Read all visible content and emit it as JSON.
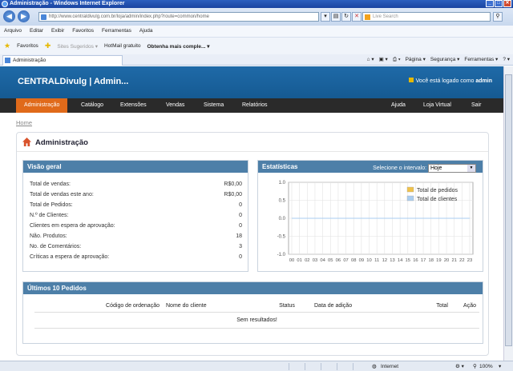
{
  "window": {
    "title": "Administração - Windows Internet Explorer"
  },
  "browser": {
    "url": "http://www.centraldivulg.com.br/loja/admin/index.php?route=common/home",
    "search_placeholder": "Live Search",
    "menu": [
      "Arquivo",
      "Editar",
      "Exibir",
      "Favoritos",
      "Ferramentas",
      "Ajuda"
    ],
    "favorites": {
      "label": "Favoritos",
      "items": [
        "Sites Sugeridos ▾",
        "HotMail gratuito",
        "Obtenha mais comple... ▾"
      ]
    },
    "tab_title": "Administração",
    "commands": [
      "Página ▾",
      "Segurança ▾",
      "Ferramentas ▾"
    ],
    "status": {
      "zone": "Internet",
      "zoom": "100%"
    }
  },
  "app": {
    "title": "CENTRALDivulg | Admin...",
    "login_note_prefix": "Você está logado como",
    "login_user": "admin",
    "menu": [
      "Administração",
      "Catálogo",
      "Extensões",
      "Vendas",
      "Sistema",
      "Relatórios"
    ],
    "menu_right": [
      "Ajuda",
      "Loja Virtual",
      "Sair"
    ],
    "breadcrumb": "Home",
    "heading": "Administração"
  },
  "overview": {
    "title": "Visão geral",
    "rows": [
      {
        "label": "Total de vendas:",
        "value": "R$0,00"
      },
      {
        "label": "Total de vendas este ano:",
        "value": "R$0,00"
      },
      {
        "label": "Total de Pedidos:",
        "value": "0"
      },
      {
        "label": "N.º de Clientes:",
        "value": "0"
      },
      {
        "label": "Clientes em espera de aprovação:",
        "value": "0"
      },
      {
        "label": "Não. Produtos:",
        "value": "18"
      },
      {
        "label": "No. de Comentários:",
        "value": "3"
      },
      {
        "label": "Críticas a espera de aprovação:",
        "value": "0"
      }
    ]
  },
  "stats": {
    "title": "Estatísticas",
    "range_label": "Selecione o intervalo:",
    "range_value": "Hoje"
  },
  "orders": {
    "title": "Últimos 10 Pedidos",
    "columns": [
      "Código de ordenação",
      "Nome do cliente",
      "Status",
      "Data de adição",
      "Total",
      "Ação"
    ],
    "empty": "Sem resultados!"
  },
  "chart_data": {
    "type": "line",
    "x": [
      "00",
      "01",
      "02",
      "03",
      "04",
      "05",
      "06",
      "07",
      "08",
      "09",
      "10",
      "11",
      "12",
      "13",
      "14",
      "15",
      "16",
      "17",
      "18",
      "19",
      "20",
      "21",
      "22",
      "23"
    ],
    "series": [
      {
        "name": "Total de pedidos",
        "color": "#f0c24a",
        "values": [
          0,
          0,
          0,
          0,
          0,
          0,
          0,
          0,
          0,
          0,
          0,
          0,
          0,
          0,
          0,
          0,
          0,
          0,
          0,
          0,
          0,
          0,
          0,
          0
        ]
      },
      {
        "name": "Total de clientes",
        "color": "#a9cdf0",
        "values": [
          0,
          0,
          0,
          0,
          0,
          0,
          0,
          0,
          0,
          0,
          0,
          0,
          0,
          0,
          0,
          0,
          0,
          0,
          0,
          0,
          0,
          0,
          0,
          0
        ]
      }
    ],
    "yticks": [
      "1.0",
      "0.5",
      "0.0",
      "-0.5",
      "-1.0"
    ],
    "ylim": [
      -1.0,
      1.0
    ],
    "grid": true,
    "legend": "top-right"
  }
}
